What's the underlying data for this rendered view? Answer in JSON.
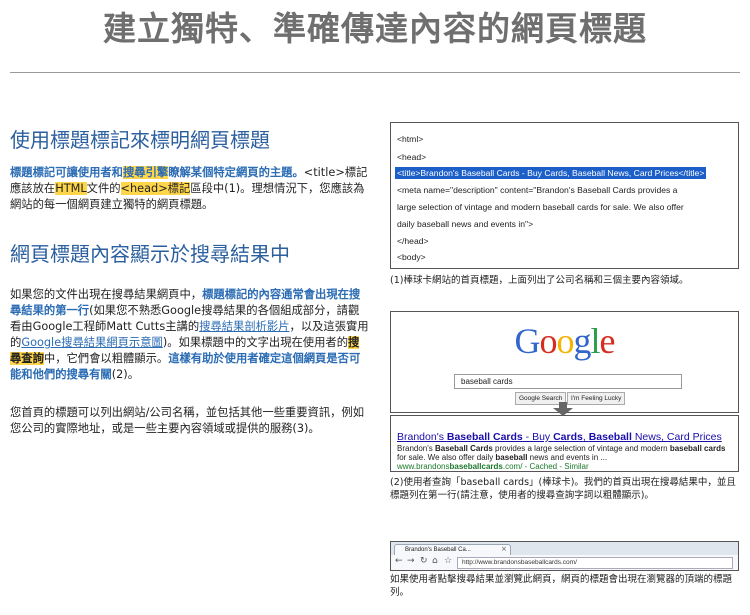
{
  "page_title": "建立獨特、準確傳達內容的網頁標題",
  "section1": {
    "heading": "使用標題標記來標明網頁標題",
    "p1": {
      "a": "標題標記可讓使用者和",
      "b": "搜尋引擎",
      "c": "瞭解某個特定網頁的主題。",
      "d": "<title>標記應該放在",
      "e": "HTML",
      "f": "文件的",
      "g": "<head>標記",
      "h": "區段中(1)。",
      "i": "理想情況下，您應該為網站的每一個網頁建立獨特的網頁標題。"
    }
  },
  "section2": {
    "heading": "網頁標題內容顯示於搜尋結果中",
    "p2": {
      "a": "如果您的文件出現在搜尋結果網頁中，",
      "b": "標題標記的內容通常會出現在搜尋結果的第一行",
      "c": "(如果您不熟悉Google搜尋結果的各個組成部分，請觀看由Google工程師Matt Cutts主講的",
      "d": "搜尋結果剖析影片",
      "e": "，以及這張實用的",
      "f": "Google搜尋結果網頁示意圖",
      "g": ")。如果標題中的文字出現在使用者的",
      "h": "搜尋查詢",
      "i": "中，它們會以粗體顯示。",
      "j": "這樣有助於使用者確定這個網頁是否可能和他們的搜尋有關",
      "k": "(2)。"
    },
    "p3": "您首頁的標題可以列出網站/公司名稱，並包括其他一些重要資訊，例如您公司的實際地址，或是一些主要內容領域或提供的服務(3)。"
  },
  "code_example": {
    "lines": [
      "<html>",
      "<head>",
      "<title>Brandon's Baseball Cards - Buy Cards, Baseball News, Card Prices</title>",
      "<meta name=\"description\" content=\"Brandon's Baseball Cards provides a",
      "large selection of vintage and modern baseball cards for sale. We also offer",
      "daily baseball news and events in\">",
      "</head>",
      "<body>"
    ],
    "caption": "(1)棒球卡網站的首頁標題，上面列出了公司名稱和三個主要內容領域。"
  },
  "google_example": {
    "logo": [
      "G",
      "o",
      "o",
      "g",
      "l",
      "e"
    ],
    "logo_colors": [
      "#3366cc",
      "#d62d20",
      "#f4b400",
      "#3366cc",
      "#2a9d4a",
      "#d62d20"
    ],
    "query": "baseball cards",
    "btn_search": "Google Search",
    "btn_lucky": "I'm Feeling Lucky",
    "result_title": {
      "a": "Brandon's ",
      "b": "Baseball Cards",
      "c": " - Buy ",
      "d": "Cards",
      "e": ", ",
      "f": "Baseball",
      "g": " News, Card Prices"
    },
    "result_desc": {
      "a": "Brandon's ",
      "b": "Baseball Cards",
      "c": " provides a large selection of vintage and modern ",
      "d": "baseball cards",
      "e": " for sale. We also offer daily ",
      "f": "baseball",
      "g": " news and events in ..."
    },
    "result_url": {
      "a": "www.brandons",
      "b": "baseballcards",
      "c": ".com/ - Cached - Similar"
    },
    "caption": "(2)使用者查詢「baseball cards」(棒球卡)。我們的首頁出現在搜尋結果中，並且標題列在第一行(請注意，使用者的搜尋查詢字詞以粗體顯示)。"
  },
  "browser_example": {
    "tab_label": "Brandon's Baseball Ca...",
    "tab_close": "×",
    "url": "http://www.brandonsbaseballcards.com/",
    "caption": "如果使用者點擊搜尋結果並瀏覽此網頁，網頁的標題會出現在瀏覽器的頂端的標題列。"
  }
}
